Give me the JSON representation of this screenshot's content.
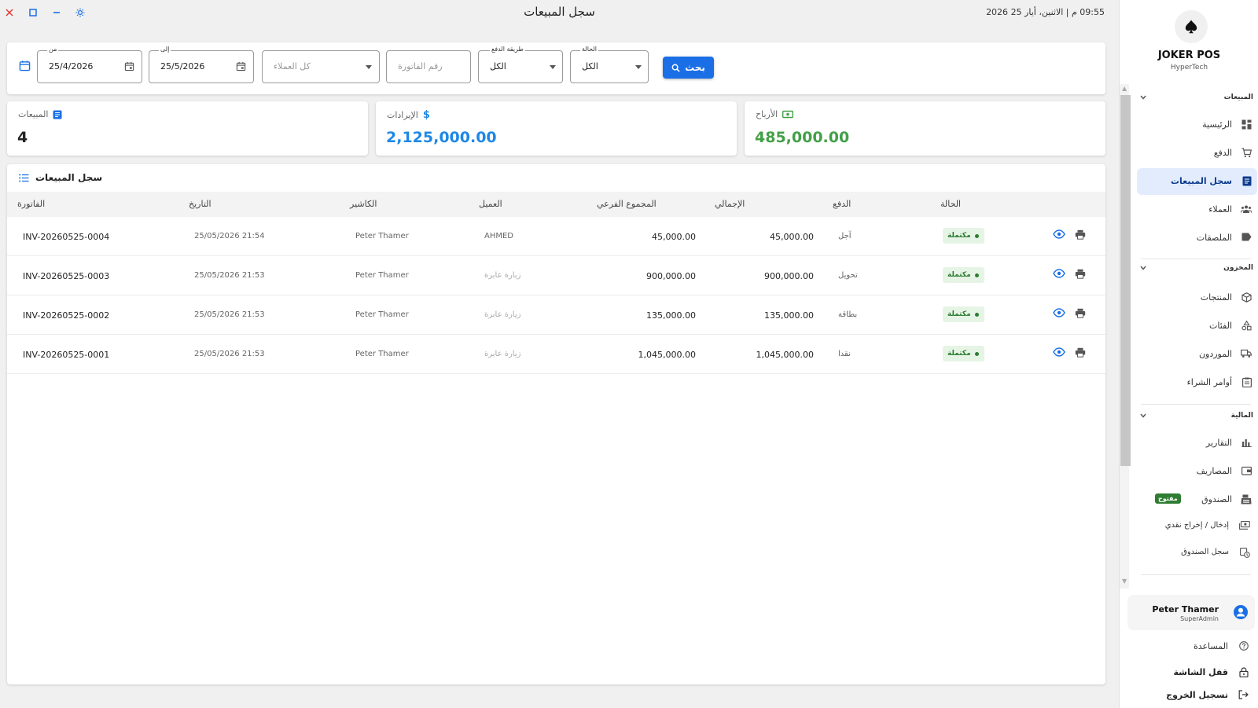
{
  "window": {
    "title": "سجل المبيعات",
    "datetime": "09:55 م  |  الاثنين، أيار 25 2026"
  },
  "filters": {
    "from_label": "من",
    "from_value": "25/4/2026",
    "to_label": "إلى",
    "to_value": "25/5/2026",
    "customer_placeholder": "كل العملاء",
    "invoice_placeholder": "رقم الفاتورة",
    "payment_label": "طريقة الدفع",
    "payment_value": "الكل",
    "status_label": "الحالة",
    "status_value": "الكل",
    "search_button": "بحث"
  },
  "stats": {
    "sales": {
      "label": "المبيعات",
      "value": "4"
    },
    "revenue": {
      "label": "الإيرادات",
      "value": "2,125,000.00"
    },
    "profit": {
      "label": "الأرباح",
      "value": "485,000.00"
    }
  },
  "table": {
    "title": "سجل المبيعات",
    "columns": {
      "invoice": "الفاتورة",
      "date": "التاريخ",
      "cashier": "الكاشير",
      "customer": "العميل",
      "subtotal": "المجموع الفرعي",
      "total": "الإجمالي",
      "payment": "الدفع",
      "status": "الحالة"
    },
    "rows": [
      {
        "invoice": "INV-20260525-0004",
        "date": "25/05/2026  21:54",
        "cashier": "Peter Thamer",
        "customer": "AHMED",
        "subtotal": "45,000.00",
        "total": "45,000.00",
        "payment": "آجل",
        "status": "مكتملة"
      },
      {
        "invoice": "INV-20260525-0003",
        "date": "25/05/2026  21:53",
        "cashier": "Peter Thamer",
        "customer": "زبارة عابرة",
        "subtotal": "900,000.00",
        "total": "900,000.00",
        "payment": "تحويل",
        "status": "مكتملة"
      },
      {
        "invoice": "INV-20260525-0002",
        "date": "25/05/2026  21:53",
        "cashier": "Peter Thamer",
        "customer": "زيارة عابرة",
        "subtotal": "135,000.00",
        "total": "135,000.00",
        "payment": "بطاقة",
        "status": "مكتملة"
      },
      {
        "invoice": "INV-20260525-0001",
        "date": "25/05/2026  21:53",
        "cashier": "Peter Thamer",
        "customer": "زيارة عابرة",
        "subtotal": "1,045,000.00",
        "total": "1,045,000.00",
        "payment": "نقدا",
        "status": "مكتملة"
      }
    ]
  },
  "sidebar": {
    "brand": "JOKER POS",
    "sub": "HyperTech",
    "sections": {
      "sales": "المبيعات",
      "inventory": "المخزون",
      "finance": "المالية"
    },
    "items": {
      "home": "الرئيسية",
      "pay": "الدفع",
      "sales_log": "سجل المبيعات",
      "customers": "العملاء",
      "stickers": "الملصقات",
      "products": "المنتجات",
      "categories": "الفئات",
      "suppliers": "الموردون",
      "purchase_orders": "أوامر الشراء",
      "reports": "التقارير",
      "expenses": "المصاريف",
      "cashbox": "الصندوق",
      "cashbox_badge": "مفتوح",
      "cash_in_out": "إدخال / إخراج نقدي",
      "cashbox_log": "سجل الصندوق"
    },
    "user": {
      "name": "Peter Thamer",
      "role": "SuperAdmin"
    },
    "bottom": {
      "help": "المساعدة",
      "lock": "قفل الشاشة",
      "logout": "تسجيل الخروج"
    }
  },
  "colors": {
    "primary": "#1a6fe6",
    "revenue": "#1e88e5",
    "profit": "#43a047",
    "success_badge": "#2e7d32",
    "close": "#e53935"
  }
}
